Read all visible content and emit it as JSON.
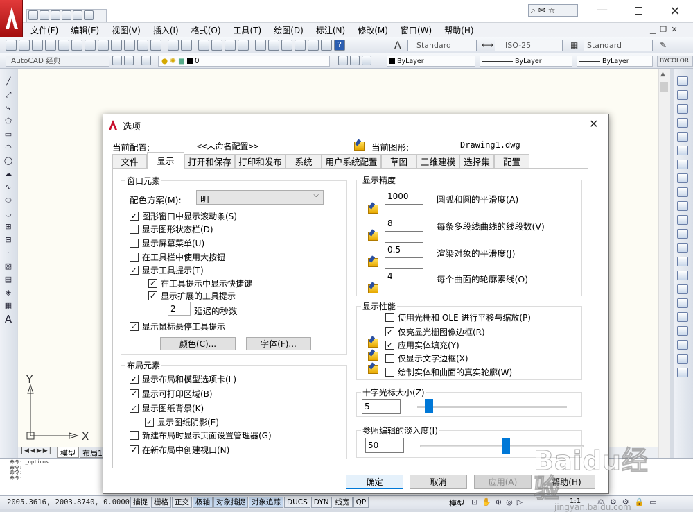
{
  "app": {
    "menu": [
      "文件(F)",
      "编辑(E)",
      "视图(V)",
      "插入(I)",
      "格式(O)",
      "工具(T)",
      "绘图(D)",
      "标注(N)",
      "修改(M)",
      "窗口(W)",
      "帮助(H)"
    ],
    "text_style": "Standard",
    "dim_style": "ISO-25",
    "table_style": "Standard",
    "workspace": "AutoCAD 经典",
    "layer": "0",
    "color": "ByLayer",
    "linetype": "ByLayer",
    "lineweight": "ByLayer",
    "plotstyle": "BYCOLOR",
    "layout_tabs": [
      "模型",
      "布局1"
    ],
    "command_lines": [
      "命令: _options",
      "命令:",
      "命令:",
      "命令:"
    ],
    "coords": "2005.3616, 2003.8740, 0.0000",
    "status_buttons": [
      "捕捉",
      "栅格",
      "正交",
      "极轴",
      "对象捕捉",
      "对象追踪",
      "DUCS",
      "DYN",
      "线宽",
      "QP"
    ],
    "status_right": [
      "模型",
      "1:1"
    ],
    "ucs_x": "X",
    "ucs_y": "Y"
  },
  "dialog": {
    "title": "选项",
    "profile_label": "当前配置:",
    "profile_value": "<<未命名配置>>",
    "drawing_label": "当前图形:",
    "drawing_value": "Drawing1.dwg",
    "tabs": [
      "文件",
      "显示",
      "打开和保存",
      "打印和发布",
      "系统",
      "用户系统配置",
      "草图",
      "三维建模",
      "选择集",
      "配置"
    ],
    "active_tab": "显示",
    "window_elements": {
      "title": "窗口元素",
      "scheme_label": "配色方案(M):",
      "scheme_value": "明",
      "cb": [
        {
          "label": "图形窗口中显示滚动条(S)",
          "checked": true
        },
        {
          "label": "显示图形状态栏(D)",
          "checked": false
        },
        {
          "label": "显示屏幕菜单(U)",
          "checked": false
        },
        {
          "label": "在工具栏中使用大按钮",
          "checked": false
        },
        {
          "label": "显示工具提示(T)",
          "checked": true
        },
        {
          "label": "在工具提示中显示快捷键",
          "checked": true
        },
        {
          "label": "显示扩展的工具提示",
          "checked": true
        },
        {
          "label": "显示鼠标悬停工具提示",
          "checked": true
        }
      ],
      "delay_value": "2",
      "delay_label": "延迟的秒数",
      "colors_btn": "颜色(C)...",
      "fonts_btn": "字体(F)..."
    },
    "layout_elements": {
      "title": "布局元素",
      "cb": [
        {
          "label": "显示布局和模型选项卡(L)",
          "checked": true
        },
        {
          "label": "显示可打印区域(B)",
          "checked": true
        },
        {
          "label": "显示图纸背景(K)",
          "checked": true
        },
        {
          "label": "显示图纸阴影(E)",
          "checked": true
        },
        {
          "label": "新建布局时显示页面设置管理器(G)",
          "checked": false
        },
        {
          "label": "在新布局中创建视口(N)",
          "checked": true
        }
      ]
    },
    "display_resolution": {
      "title": "显示精度",
      "items": [
        {
          "value": "1000",
          "label": "圆弧和圆的平滑度(A)"
        },
        {
          "value": "8",
          "label": "每条多段线曲线的线段数(V)"
        },
        {
          "value": "0.5",
          "label": "渲染对象的平滑度(J)"
        },
        {
          "value": "4",
          "label": "每个曲面的轮廓素线(O)"
        }
      ]
    },
    "display_performance": {
      "title": "显示性能",
      "cb": [
        {
          "label": "使用光栅和 OLE 进行平移与缩放(P)",
          "checked": false
        },
        {
          "label": "仅亮显光栅图像边框(R)",
          "checked": true
        },
        {
          "label": "应用实体填充(Y)",
          "checked": true
        },
        {
          "label": "仅显示文字边框(X)",
          "checked": false
        },
        {
          "label": "绘制实体和曲面的真实轮廓(W)",
          "checked": false
        }
      ]
    },
    "crosshair": {
      "title": "十字光标大小(Z)",
      "value": "5",
      "fraction": 0.05
    },
    "xref_fade": {
      "title": "参照编辑的淡入度(I)",
      "value": "50",
      "fraction": 0.5
    },
    "buttons": {
      "ok": "确定",
      "cancel": "取消",
      "apply": "应用(A)",
      "help": "帮助(H)"
    }
  },
  "watermark": {
    "brand": "Baidu经验",
    "url": "jingyan.baidu.com"
  },
  "colors": {
    "accent": "#0078d7",
    "app_red": "#c8102e",
    "canvas": "#fdfcf4"
  }
}
